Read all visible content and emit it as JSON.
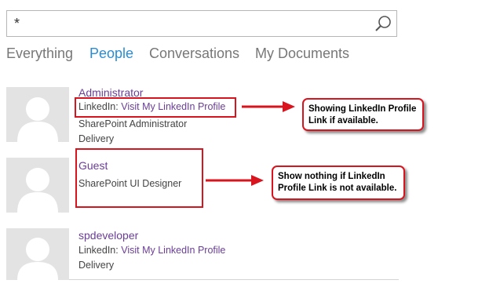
{
  "search": {
    "value": "*"
  },
  "tabs": [
    {
      "label": "Everything",
      "active": false
    },
    {
      "label": "People",
      "active": true
    },
    {
      "label": "Conversations",
      "active": false
    },
    {
      "label": "My Documents",
      "active": false
    }
  ],
  "results": [
    {
      "name": "Administrator",
      "linkedin_label": "LinkedIn: ",
      "linkedin_link": "Visit My LinkedIn Profile",
      "title": "SharePoint Administrator",
      "department": "Delivery"
    },
    {
      "name": "Guest",
      "title": "SharePoint UI Designer"
    },
    {
      "name": "spdeveloper",
      "linkedin_label": "LinkedIn: ",
      "linkedin_link": "Visit My LinkedIn Profile",
      "department": "Delivery"
    }
  ],
  "callouts": [
    {
      "text": "Showing LinkedIn Profile\nLink if available."
    },
    {
      "text": "Show nothing if LinkedIn\nProfile Link is not available."
    }
  ],
  "colors": {
    "accent_blue": "#2a8dd4",
    "name_purple": "#6a3e96",
    "annotation_red": "#d8141e"
  }
}
